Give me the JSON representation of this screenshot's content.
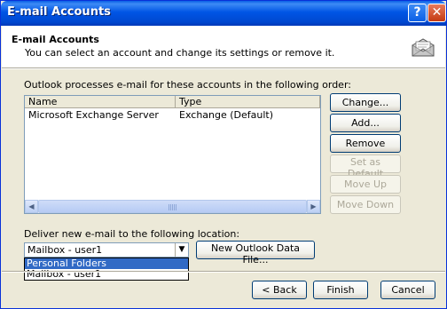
{
  "window": {
    "title": "E-mail Accounts",
    "help_glyph": "?",
    "close_glyph": "✕"
  },
  "header": {
    "title": "E-mail Accounts",
    "subtitle": "You can select an account and change its settings or remove it."
  },
  "accounts": {
    "intro": "Outlook processes e-mail for these accounts in the following order:",
    "columns": [
      "Name",
      "Type"
    ],
    "rows": [
      {
        "name": "Microsoft Exchange Server",
        "type": "Exchange (Default)"
      }
    ]
  },
  "side_buttons": {
    "change": "Change...",
    "add": "Add...",
    "remove": "Remove",
    "set_default": "Set as Default",
    "move_up": "Move Up",
    "move_down": "Move Down"
  },
  "delivery": {
    "label": "Deliver new e-mail to the following location:",
    "selected": "Mailbox - user1",
    "options": [
      "Personal Folders",
      "Mailbox - user1"
    ],
    "new_data_file": "New Outlook Data File..."
  },
  "footer": {
    "back": "< Back",
    "finish": "Finish",
    "cancel": "Cancel"
  },
  "scrollbar": {
    "left": "◀",
    "right": "▶"
  },
  "combo_arrow": "▼"
}
